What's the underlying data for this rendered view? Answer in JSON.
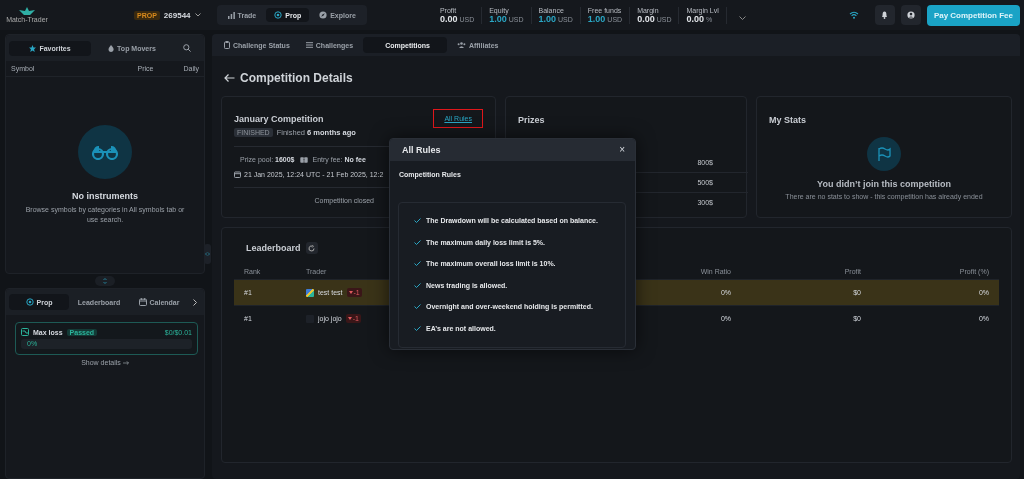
{
  "topbar": {
    "logo": "Match-Trader",
    "account_badge": "PROP",
    "account_number": "269544",
    "nav": [
      {
        "label": "Trade",
        "selected": false
      },
      {
        "label": "Prop",
        "selected": true
      },
      {
        "label": "Explore",
        "selected": false
      }
    ],
    "stats": [
      {
        "label": "Profit",
        "value": "0.00",
        "unit": "USD",
        "accent": false
      },
      {
        "label": "Equity",
        "value": "1.00",
        "unit": "USD",
        "accent": true
      },
      {
        "label": "Balance",
        "value": "1.00",
        "unit": "USD",
        "accent": true
      },
      {
        "label": "Free funds",
        "value": "1.00",
        "unit": "USD",
        "accent": true
      },
      {
        "label": "Margin",
        "value": "0.00",
        "unit": "USD",
        "accent": false
      },
      {
        "label": "Margin Lvl",
        "value": "0.00",
        "unit": "%",
        "accent": false
      }
    ],
    "cta": "Pay Competition Fee"
  },
  "sidebar": {
    "tabs": [
      {
        "label": "Favorites",
        "selected": true
      },
      {
        "label": "Top Movers",
        "selected": false
      }
    ],
    "columns": [
      "Symbol",
      "Price",
      "Daily"
    ],
    "empty_title": "No instruments",
    "empty_text": "Browse symbols by categories in All symbols tab or use search.",
    "bottom_tabs": [
      {
        "label": "Prop",
        "selected": true
      },
      {
        "label": "Leaderboard",
        "selected": false
      },
      {
        "label": "Calendar",
        "selected": false
      }
    ],
    "objective": {
      "name": "Max loss",
      "status": "Passed",
      "amount": "$0/$0.01",
      "level": 0,
      "reading": "0%"
    },
    "details_link": "Show details"
  },
  "main": {
    "tabs": [
      {
        "label": "Challenge Status",
        "selected": false
      },
      {
        "label": "Challenges",
        "selected": false
      },
      {
        "label": "Competitions",
        "selected": true
      },
      {
        "label": "Affiliates",
        "selected": false
      }
    ],
    "title": "Competition Details",
    "competition": {
      "name": "January Competition",
      "rules_link": "All Rules",
      "status": "FINISHED",
      "finished_prefix": "Finished",
      "finished_ago": "6 months ago",
      "prize_pool_label": "Prize pool:",
      "prize_pool": "1600$",
      "entry_fee_label": "Entry fee:",
      "entry_fee": "No fee",
      "dates": "21 Jan 2025, 12:24 UTC - 21 Feb 2025, 12:2",
      "closed_note": "Competition closed"
    },
    "prizes": {
      "title": "Prizes",
      "items": [
        "800$",
        "500$",
        "300$"
      ]
    },
    "my_stats": {
      "title": "My Stats",
      "heading": "You didn’t join this competition",
      "text": "There are no stats to show - this competition has already ended"
    },
    "leaderboard": {
      "title": "Leaderboard",
      "columns": [
        "Rank",
        "Trader",
        "Win Ratio",
        "Profit",
        "Profit (%)"
      ],
      "rows": [
        {
          "rank": "#1",
          "trader": "test test",
          "change": "-1",
          "win_ratio": "0%",
          "profit": "$0",
          "profit_pct": "0%",
          "highlighted": true
        },
        {
          "rank": "#1",
          "trader": "jojo jojo",
          "change": "-1",
          "win_ratio": "0%",
          "profit": "$0",
          "profit_pct": "0%",
          "highlighted": false
        }
      ]
    }
  },
  "modal": {
    "title": "All Rules",
    "close": "×",
    "subtitle": "Competition Rules",
    "rules": [
      "The Drawdown will be calculated based on balance.",
      "The maximum daily loss limit is 5%.",
      "The maximum overall loss limit is 10%.",
      "News trading is allowed.",
      "Overnight and over-weekend holding is permitted.",
      "EA’s are not allowed."
    ]
  }
}
